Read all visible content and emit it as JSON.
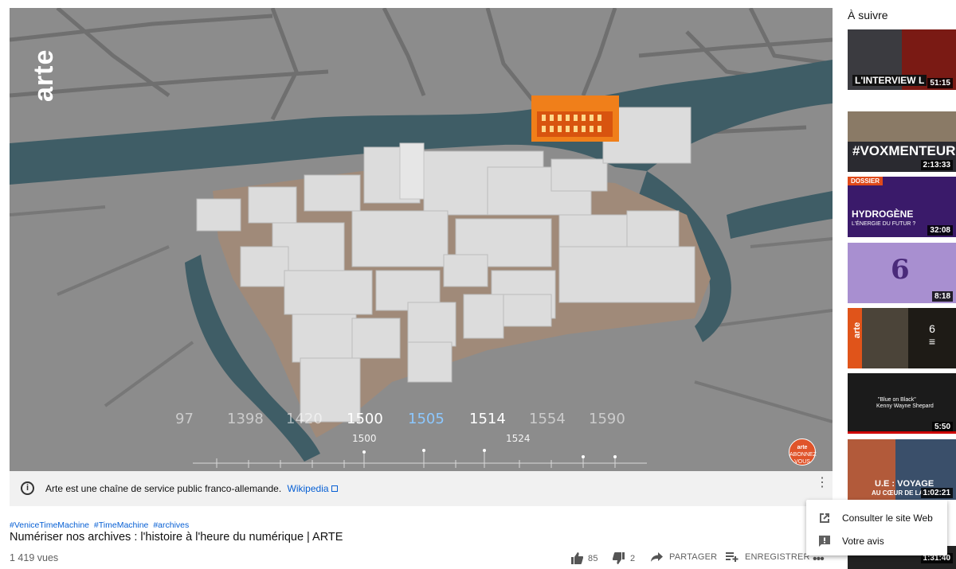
{
  "player": {
    "channel_logo": "arte",
    "timeline": {
      "years": [
        "97",
        "1398",
        "1420",
        "1500",
        "1505",
        "1514",
        "1554",
        "1590"
      ],
      "markers": [
        "1500",
        "1524"
      ]
    },
    "subscribe_badge": [
      "arte",
      "ABONNEZ",
      "VOUS"
    ]
  },
  "info_panel": {
    "text": "Arte est une chaîne de service public franco-allemande.",
    "link": "Wikipedia",
    "icon": "info-icon"
  },
  "video": {
    "hashtags": [
      "#VeniceTimeMachine",
      "#TimeMachine",
      "#archives"
    ],
    "title": "Numériser nos archives : l'histoire à l'heure du numérique | ARTE",
    "views": "1 419 vues",
    "likes": "85",
    "dislikes": "2",
    "share_label": "PARTAGER",
    "save_label": "ENREGISTRER"
  },
  "sidebar": {
    "heading": "À suivre",
    "items": [
      {
        "overlay": "L'INTERVIEW L",
        "duration": "51:15",
        "bg": "#4a1410"
      },
      {
        "overlay": "#VOXMENTEUR",
        "duration": "2:13:33",
        "bg": "#2a2a30"
      },
      {
        "overlay": "HYDROGÈNE",
        "subtitle": "L'ÉNERGIE DU FUTUR ?",
        "badge": "DOSSIER",
        "duration": "32:08",
        "bg": "#3a1a6a"
      },
      {
        "overlay": "6",
        "duration": "8:18",
        "bg": "#a88fd0"
      },
      {
        "overlay": "arte",
        "count": "6",
        "bg": "#4b4439"
      },
      {
        "overlay": "\"Blue on Black\"",
        "subtitle": "Kenny Wayne Shepard",
        "duration": "5:50",
        "bg": "#1b1b1b"
      },
      {
        "overlay": "U.E : VOYAGE",
        "subtitle": "AU CŒUR DE LA M",
        "duration": "1:02:21",
        "bg": "#3a4f6a"
      },
      {
        "duration": "1:31:40",
        "bg": "#222"
      }
    ]
  },
  "context_menu": {
    "items": [
      {
        "label": "Consulter le site Web",
        "icon": "open-in-new-icon"
      },
      {
        "label": "Votre avis",
        "icon": "feedback-icon"
      }
    ]
  },
  "colors": {
    "link": "#065fd4",
    "water": "#3f5d66",
    "land": "#8c8c8c",
    "highlight": "#f07f1a"
  }
}
